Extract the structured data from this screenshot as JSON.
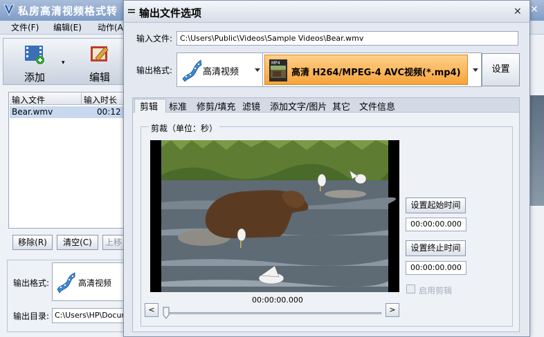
{
  "main": {
    "title": "私房高清视频格式转",
    "menu": [
      "文件(F)",
      "编辑(E)",
      "动作(A"
    ],
    "toolbar": {
      "add_label": "添加",
      "edit_label": "编辑"
    },
    "table": {
      "headers": [
        "输入文件",
        "输入时长"
      ],
      "rows": [
        {
          "file": "Bear.wmv",
          "duration": "00:12"
        }
      ]
    },
    "buttons": {
      "remove": "移除(R)",
      "clear": "清空(C)",
      "up": "上移"
    },
    "output_format_label": "输出格式:",
    "output_format_value": "高清视频",
    "output_dir_label": "输出目录:",
    "output_dir_value": "C:\\Users\\HP\\Docume"
  },
  "dialog": {
    "title": "输出文件选项",
    "input_file_label": "输入文件:",
    "input_file_value": "C:\\Users\\Public\\Videos\\Sample Videos\\Bear.wmv",
    "output_format_label": "输出格式:",
    "category": "高清视频",
    "format": "高清 H264/MPEG-4 AVC视频(*.mp4)",
    "format_icon_text": "MP4",
    "settings_label": "设置",
    "tabs": [
      "剪辑",
      "标准",
      "修剪/填充",
      "滤镜",
      "添加文字/图片",
      "其它",
      "文件信息"
    ],
    "active_tab": "剪辑",
    "crop_group_title": "剪裁（单位：秒）",
    "current_time": "00:00:00.000",
    "seek_prev": "<",
    "seek_next": ">",
    "seek_progress": 0,
    "set_start_label": "设置起始时间",
    "start_time": "00:00:00.000",
    "set_end_label": "设置终止时间",
    "end_time": "00:00:00.000",
    "enable_crop_label": "启用剪辑",
    "enable_crop_checked": false
  },
  "icons": {
    "app": "app-logo-icon",
    "add": "film-add-icon",
    "edit": "film-edit-icon",
    "category": "film-strip-icon",
    "format": "mp4-file-icon"
  },
  "colors": {
    "format_highlight": "#f7a33a",
    "title_bar": "#7f9cc7"
  }
}
